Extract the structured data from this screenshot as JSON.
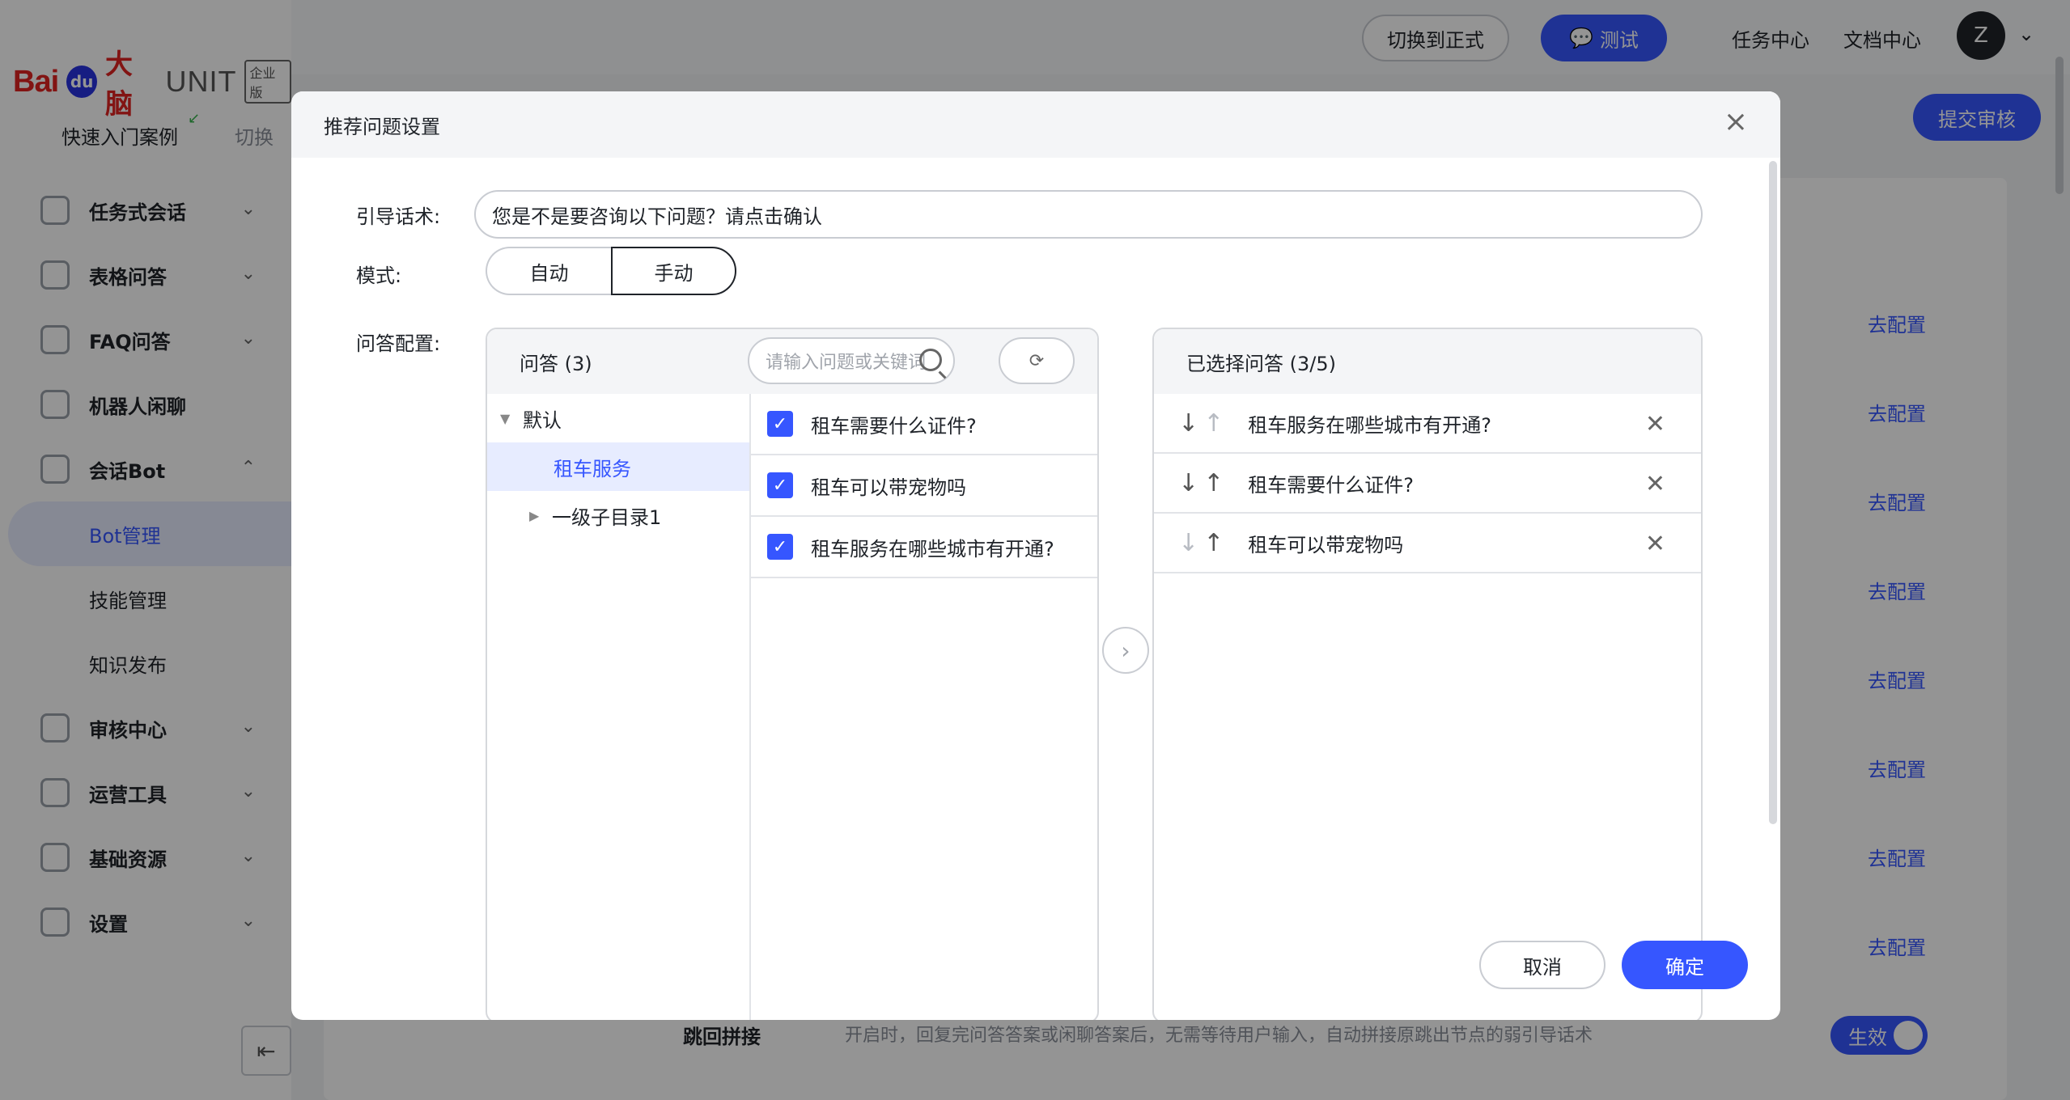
{
  "app": {
    "logo_bai": "Bai",
    "logo_paw": "du",
    "logo_brain": "大脑",
    "logo_unit": "UNIT",
    "logo_edition": "企业版",
    "project_name": "快速入门案例",
    "project_switch": "切换"
  },
  "sidebar": {
    "items": [
      {
        "label": "任务式会话",
        "icon": "task-icon"
      },
      {
        "label": "表格问答",
        "icon": "table-icon"
      },
      {
        "label": "FAQ问答",
        "icon": "faq-icon"
      },
      {
        "label": "机器人闲聊",
        "icon": "chat-icon"
      },
      {
        "label": "会话Bot",
        "icon": "bot-icon"
      }
    ],
    "sub_items": [
      "Bot管理",
      "技能管理",
      "知识发布"
    ],
    "items2": [
      {
        "label": "审核中心",
        "icon": "shield-icon"
      },
      {
        "label": "运营工具",
        "icon": "tool-icon"
      },
      {
        "label": "基础资源",
        "icon": "resource-icon"
      },
      {
        "label": "设置",
        "icon": "settings-icon"
      }
    ]
  },
  "topbar": {
    "switch_label": "切换到正式",
    "test_label": "测试",
    "task_center": "任务中心",
    "doc_center": "文档中心",
    "avatar_letter": "Z",
    "submit_label": "提交审核"
  },
  "background": {
    "config_link": "去配置",
    "row_label": "跳回拼接",
    "row_desc": "开启时，回复完问答答案或闲聊答案后，无需等待用户输入，自动拼接原跳出节点的弱引导话术",
    "toggle_label": "生效"
  },
  "modal": {
    "title": "推荐问题设置",
    "guide_label": "引导话术:",
    "guide_value": "您是不是要咨询以下问题？请点击确认",
    "mode_label": "模式:",
    "mode_auto": "自动",
    "mode_manual": "手动",
    "qa_config_label": "问答配置:",
    "qa_panel_title": "问答 (3)",
    "search_placeholder": "请输入问题或关键词",
    "tree": {
      "root": "默认",
      "selected": "租车服务",
      "child": "一级子目录1"
    },
    "qa_items": [
      "租车需要什么证件?",
      "租车可以带宠物吗",
      "租车服务在哪些城市有开通?"
    ],
    "selected_title": "已选择问答 (3/5)",
    "selected_items": [
      "租车服务在哪些城市有开通?",
      "租车需要什么证件?",
      "租车可以带宠物吗"
    ],
    "cancel_label": "取消",
    "ok_label": "确定"
  },
  "colors": {
    "primary": "#3656ff",
    "brand_red": "#e12322"
  }
}
